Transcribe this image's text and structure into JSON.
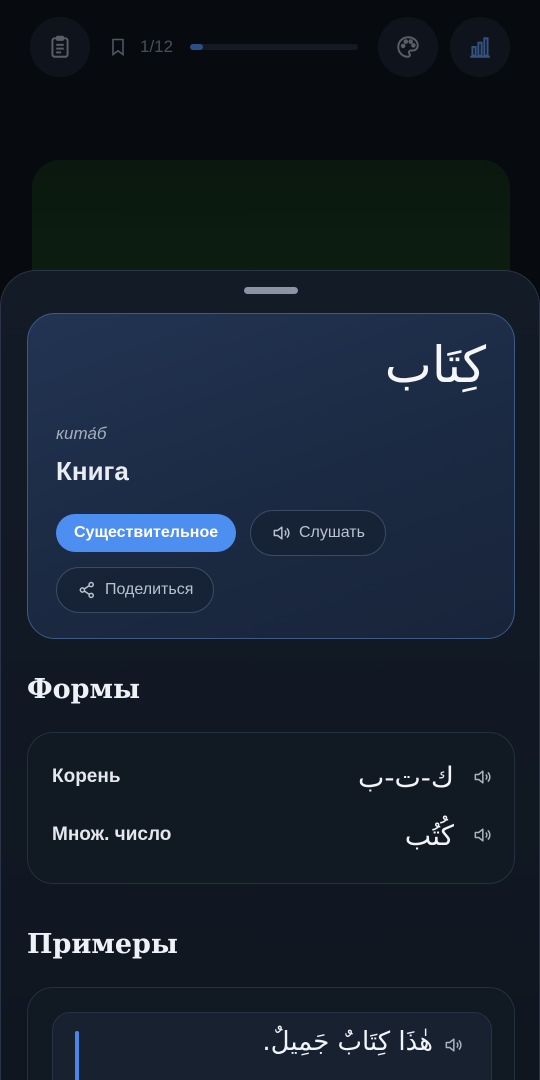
{
  "topbar": {
    "progress_text": "1/12",
    "progress_fraction": 0.08,
    "icons": [
      "list-icon",
      "bookmark-icon",
      "palette-icon",
      "stats-icon"
    ]
  },
  "word": {
    "arabic": "كِتَاب",
    "transliteration": "кита́б",
    "translation": "Книга",
    "part_of_speech": "Существительное",
    "listen_label": "Слушать",
    "share_label": "Поделиться"
  },
  "forms": {
    "title": "Формы",
    "rows": [
      {
        "label": "Корень",
        "value": "ك-ت-ب"
      },
      {
        "label": "Множ. число",
        "value": "كُتُب"
      }
    ]
  },
  "examples": {
    "title": "Примеры",
    "items": [
      {
        "arabic": "هٰذَا كِتَابٌ جَمِيلٌ."
      }
    ]
  },
  "colors": {
    "accent": "#4d8ff0",
    "background": "#05080d",
    "sheet": "#131b27",
    "card": "#223453"
  }
}
